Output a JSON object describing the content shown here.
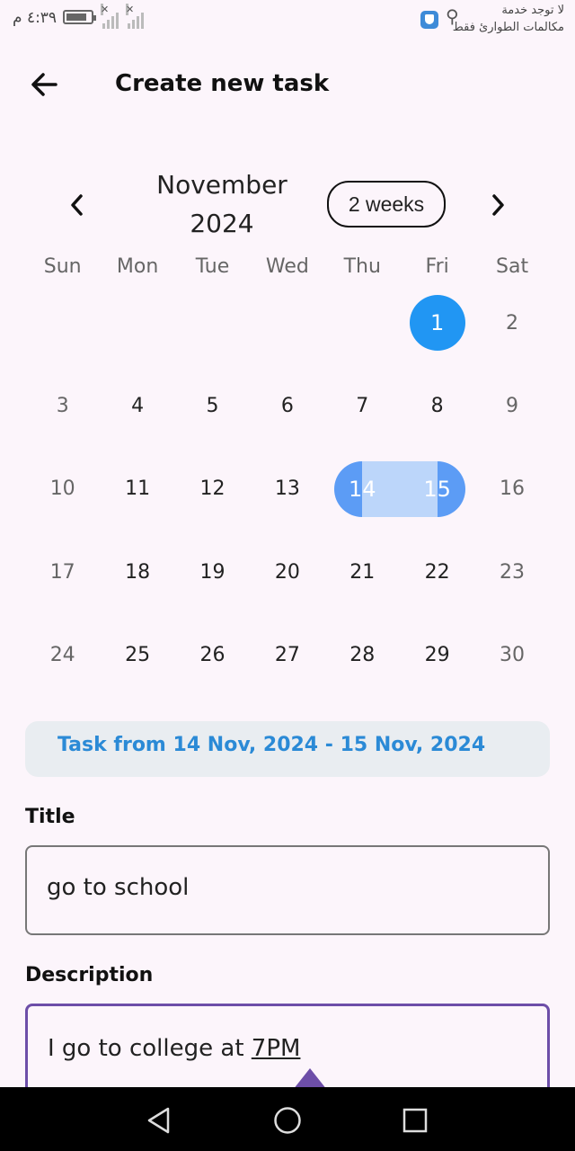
{
  "status_bar": {
    "time": "٤:٣٩ م",
    "carrier_line1": "لا توجد خدمة",
    "carrier_line2": "مكالمات الطوارئ فقط"
  },
  "app_bar": {
    "title": "Create new task"
  },
  "calendar": {
    "month_label": "November\n2024",
    "month_line1": "November",
    "month_line2": "2024",
    "format_button": "2 weeks",
    "weekdays": [
      "Sun",
      "Mon",
      "Tue",
      "Wed",
      "Thu",
      "Fri",
      "Sat"
    ],
    "weeks": [
      [
        "",
        "",
        "",
        "",
        "",
        "1",
        "2"
      ],
      [
        "3",
        "4",
        "5",
        "6",
        "7",
        "8",
        "9"
      ],
      [
        "10",
        "11",
        "12",
        "13",
        "14",
        "15",
        "16"
      ],
      [
        "17",
        "18",
        "19",
        "20",
        "21",
        "22",
        "23"
      ],
      [
        "24",
        "25",
        "26",
        "27",
        "28",
        "29",
        "30"
      ]
    ],
    "today": "1",
    "range_start": "14",
    "range_end": "15"
  },
  "summary": {
    "text": "Task from 14 Nov, 2024 - 15 Nov, 2024"
  },
  "form": {
    "title_label": "Title",
    "title_value": "go to school",
    "description_label": "Description",
    "description_value_prefix": "I go to college at ",
    "description_value_underlined": "7PM"
  },
  "colors": {
    "today": "#2196f3",
    "range": "#5c9cf5",
    "range_band": "#bcd6fa",
    "summary_text": "#2b8ad6",
    "focus": "#6d4ea8"
  }
}
